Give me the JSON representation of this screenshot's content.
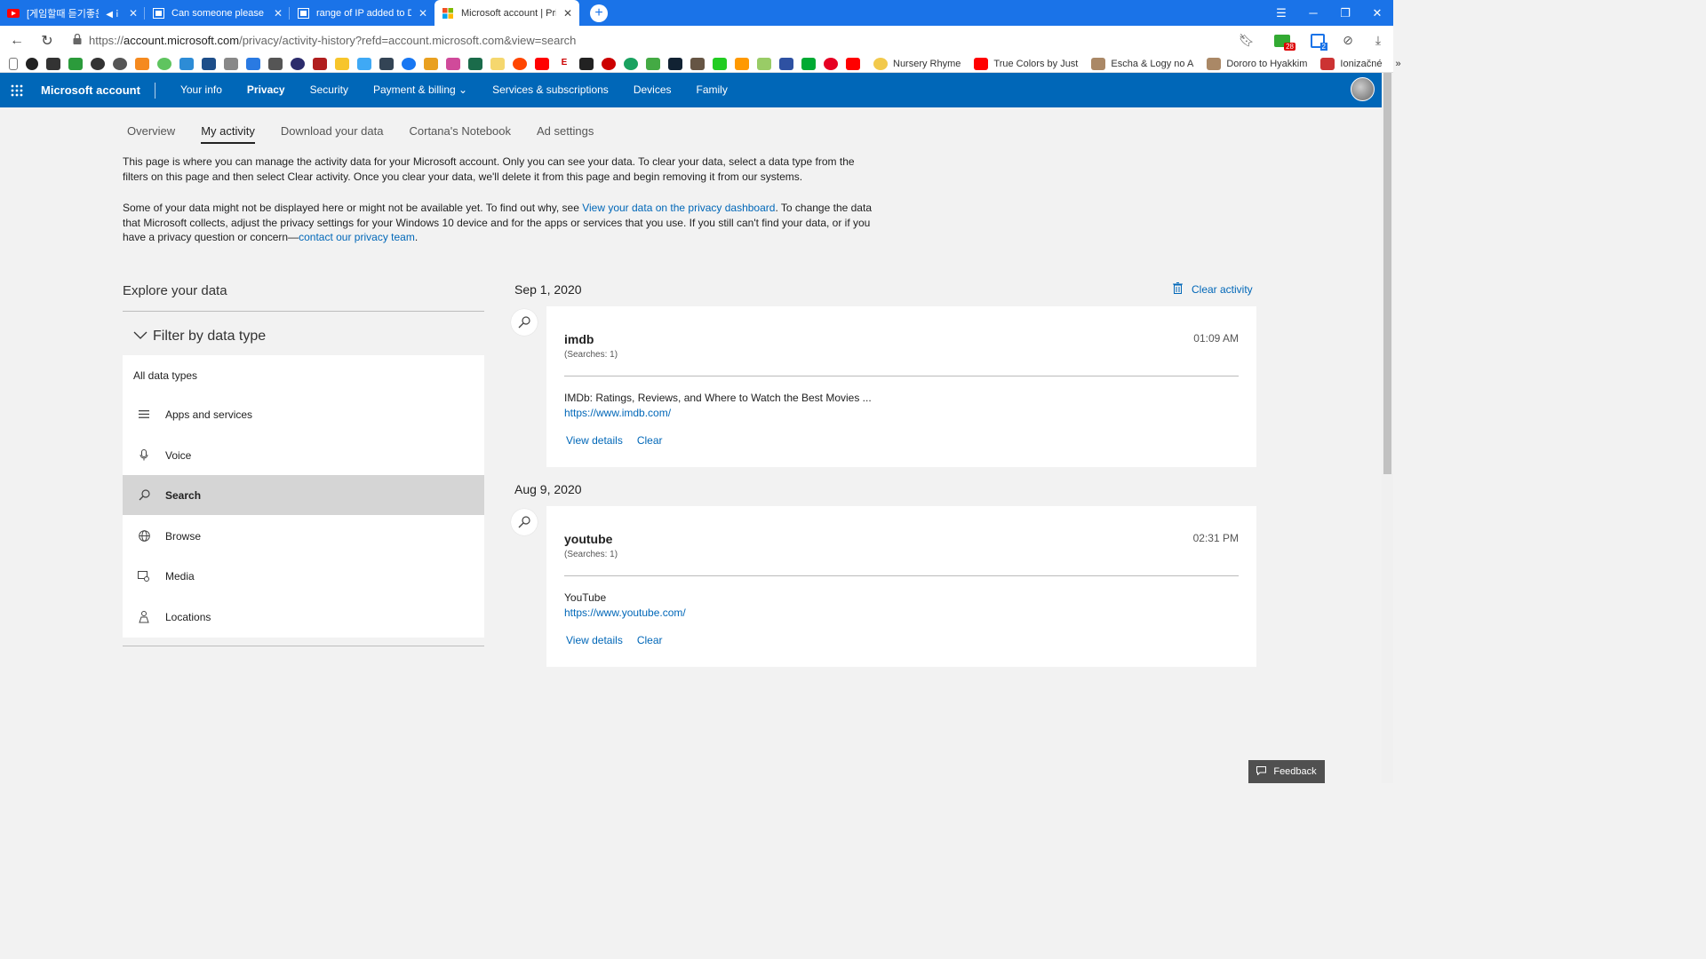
{
  "browser": {
    "tabs": [
      {
        "title": "[게임할때 듣기좋은",
        "icon": "youtube-icon",
        "active": false
      },
      {
        "title": "Can someone please tell m",
        "icon": "page-icon",
        "active": false
      },
      {
        "title": "range of IP added to DNS",
        "icon": "page-icon",
        "active": false
      },
      {
        "title": "Microsoft account | Priv",
        "icon": "microsoft-icon",
        "active": true
      }
    ],
    "url_prefix": "https://",
    "url_host": "account.microsoft.com",
    "url_path": "/privacy/activity-history?refd=account.microsoft.com&view=search",
    "bookmarks": [
      "Nursery Rhyme",
      "True Colors by Just",
      "Escha & Logy no A",
      "Dororo to Hyakkim",
      "Ionizačné"
    ],
    "extension_badge": "28",
    "extension_badge2": "2"
  },
  "header": {
    "brand": "Microsoft account",
    "nav": [
      "Your info",
      "Privacy",
      "Security",
      "Payment & billing",
      "Services & subscriptions",
      "Devices",
      "Family"
    ],
    "dropdown_caret": "⌄"
  },
  "subnav": [
    "Overview",
    "My activity",
    "Download your data",
    "Cortana's Notebook",
    "Ad settings"
  ],
  "intro": {
    "p1": "This page is where you can manage the activity data for your Microsoft account. Only you can see your data. To clear your data, select a data type from the filters on this page and then select Clear activity. Once you clear your data, we'll delete it from this page and begin removing it from our systems.",
    "p2a": "Some of your data might not be displayed here or might not be available yet. To find out why, see ",
    "p2_link": "View your data on the privacy dashboard",
    "p2b": ". To change the data that Microsoft collects, adjust the privacy settings for your Windows 10 device and for the apps or services that you use. If you still can't find your data, or if you have a privacy question or concern—",
    "p2_link2": "contact our privacy team",
    "p2c": "."
  },
  "filter": {
    "explore": "Explore your data",
    "heading": "Filter by data type",
    "all": "All data types",
    "items": [
      {
        "label": "Apps and services",
        "icon": "list-icon"
      },
      {
        "label": "Voice",
        "icon": "microphone-icon"
      },
      {
        "label": "Search",
        "icon": "search-icon"
      },
      {
        "label": "Browse",
        "icon": "globe-icon"
      },
      {
        "label": "Media",
        "icon": "media-icon"
      },
      {
        "label": "Locations",
        "icon": "location-icon"
      }
    ],
    "selected": "Search"
  },
  "activity": {
    "clear_all": "Clear activity",
    "groups": [
      {
        "date": "Sep 1, 2020",
        "query": "imdb",
        "count": "(Searches: 1)",
        "time": "01:09 AM",
        "result_title": "IMDb: Ratings, Reviews, and Where to Watch the Best Movies ...",
        "result_url": "https://www.imdb.com/",
        "details": "View details",
        "clear": "Clear"
      },
      {
        "date": "Aug 9, 2020",
        "query": "youtube",
        "count": "(Searches: 1)",
        "time": "02:31 PM",
        "result_title": "YouTube",
        "result_url": "https://www.youtube.com/",
        "details": "View details",
        "clear": "Clear"
      }
    ]
  },
  "feedback": "Feedback"
}
